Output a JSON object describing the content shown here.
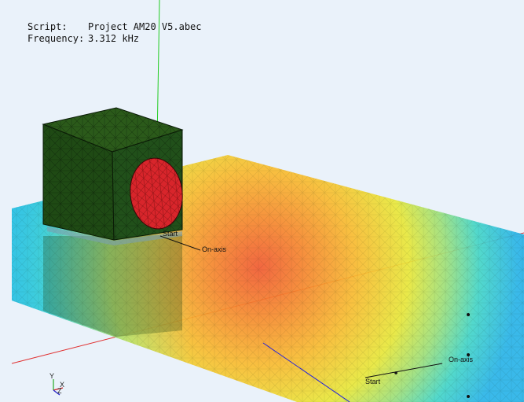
{
  "overlay": {
    "script_label": "Script:",
    "script_value": "Project AM20 V5.abec",
    "frequency_label": "Frequency:",
    "frequency_value": "3.312 kHz"
  },
  "scene": {
    "label_start_near": "Start",
    "label_onaxis_near": "On-axis",
    "label_start_far": "Start",
    "label_onaxis_far": "On-axis"
  },
  "triad": {
    "y_label": "Y",
    "x_label": "X",
    "z_label": "Z"
  },
  "colors": {
    "background": "#eaf2fa",
    "enclosure": "#1f4a14",
    "driver": "#d8252b",
    "y_axis": "#22cc22",
    "x_axis": "#e03030",
    "z_axis": "#2222dd"
  }
}
